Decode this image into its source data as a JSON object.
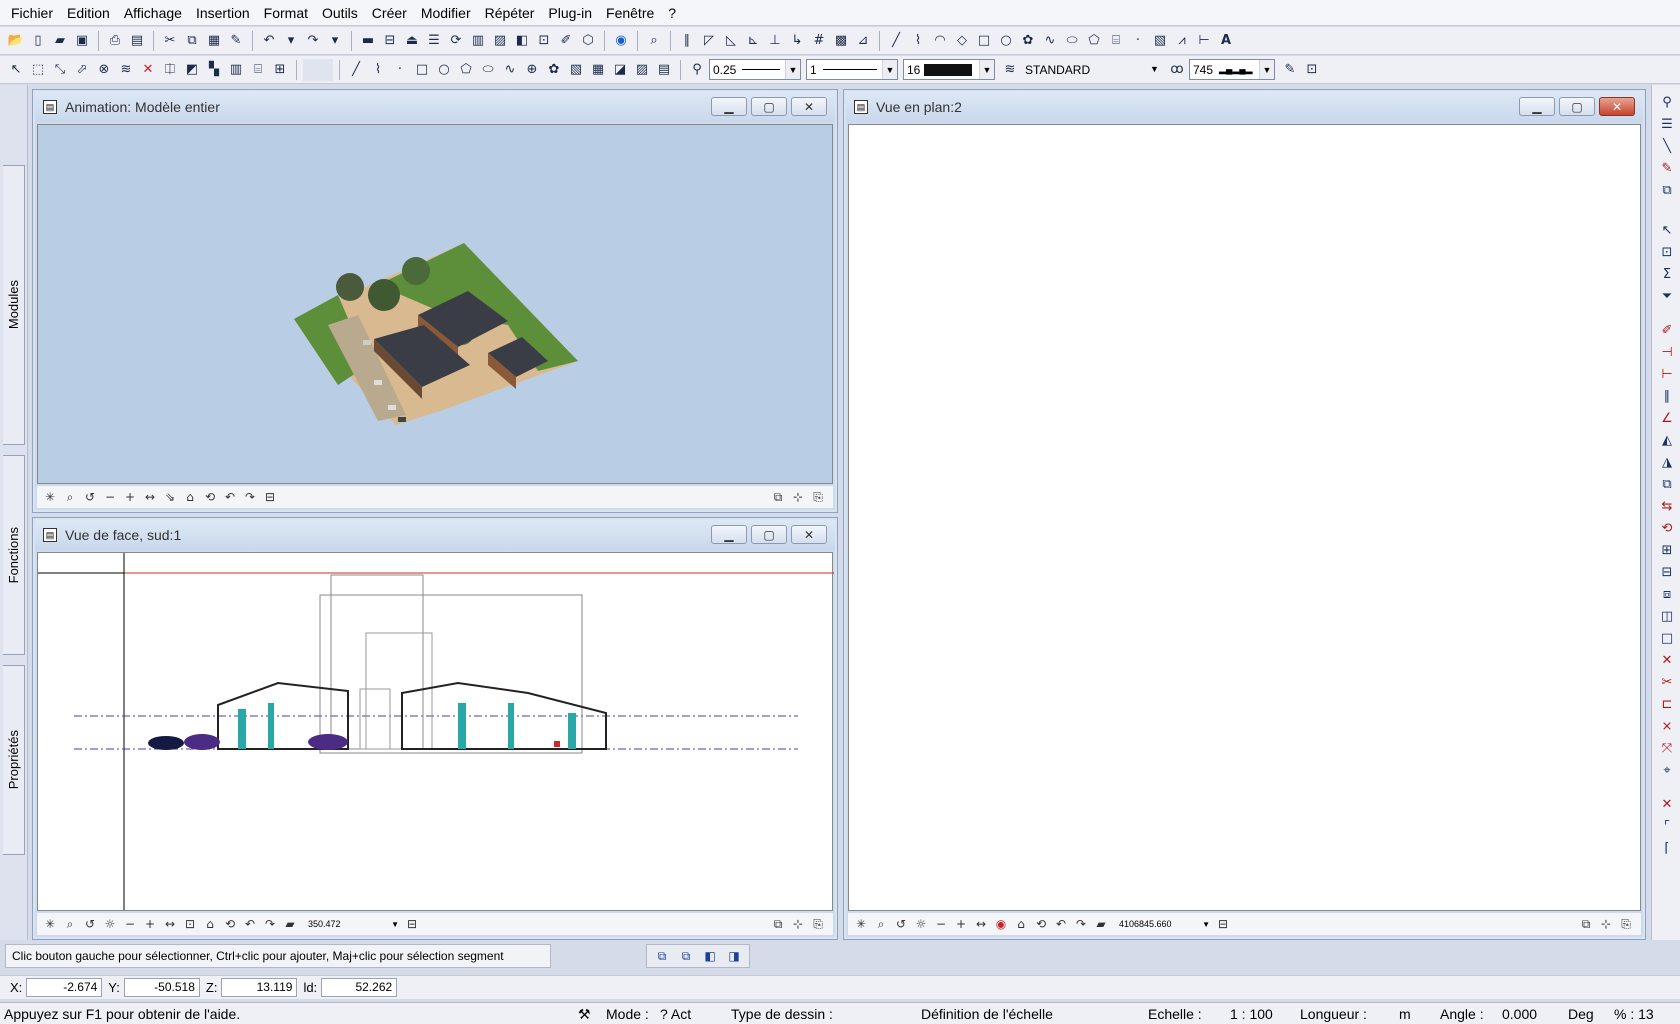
{
  "menu": [
    "Fichier",
    "Edition",
    "Affichage",
    "Insertion",
    "Format",
    "Outils",
    "Créer",
    "Modifier",
    "Répéter",
    "Plug-in",
    "Fenêtre",
    "?"
  ],
  "toolbar2": {
    "pen_thickness": "0.25",
    "line_type": "1",
    "color_index": "16",
    "layer": "STANDARD",
    "hatch": "745"
  },
  "side_tabs": {
    "modules": "Modules",
    "fonctions": "Fonctions",
    "proprietes": "Propriétés"
  },
  "windows": {
    "anim": {
      "title": "Animation: Modèle entier"
    },
    "face": {
      "title": "Vue de face, sud:1",
      "zoom_value": "350.472"
    },
    "plan": {
      "title": "Vue en plan:2",
      "zoom_value": "4106845.660"
    }
  },
  "status": {
    "message": "Clic bouton gauche pour sélectionner, Ctrl+clic pour ajouter, Maj+clic pour sélection segment",
    "coords": {
      "x_label": "X:",
      "x": "-2.674",
      "y_label": "Y:",
      "y": "-50.518",
      "z_label": "Z:",
      "z": "13.119",
      "d_label": "ld:",
      "d": "52.262"
    },
    "help": "Appuyez sur F1 pour obtenir de l'aide.",
    "mode_label": "Mode :",
    "mode_value": "? Act",
    "drawing_type": "Type de dessin :",
    "scale_def": "Définition de l'échelle",
    "scale_label": "Echelle :",
    "scale_value": "1 : 100",
    "length_label": "Longueur :",
    "length_unit": "m",
    "angle_label": "Angle :",
    "angle_value": "0.000",
    "angle_unit": "Deg",
    "percent": "% : 13"
  },
  "colors": {
    "sky": "#b9cde4",
    "ground": "#d9b98f",
    "grass": "#5d8f3a",
    "roof": "#3a3d45",
    "redline": "#cc2a2a",
    "blueline": "#4040aa"
  }
}
